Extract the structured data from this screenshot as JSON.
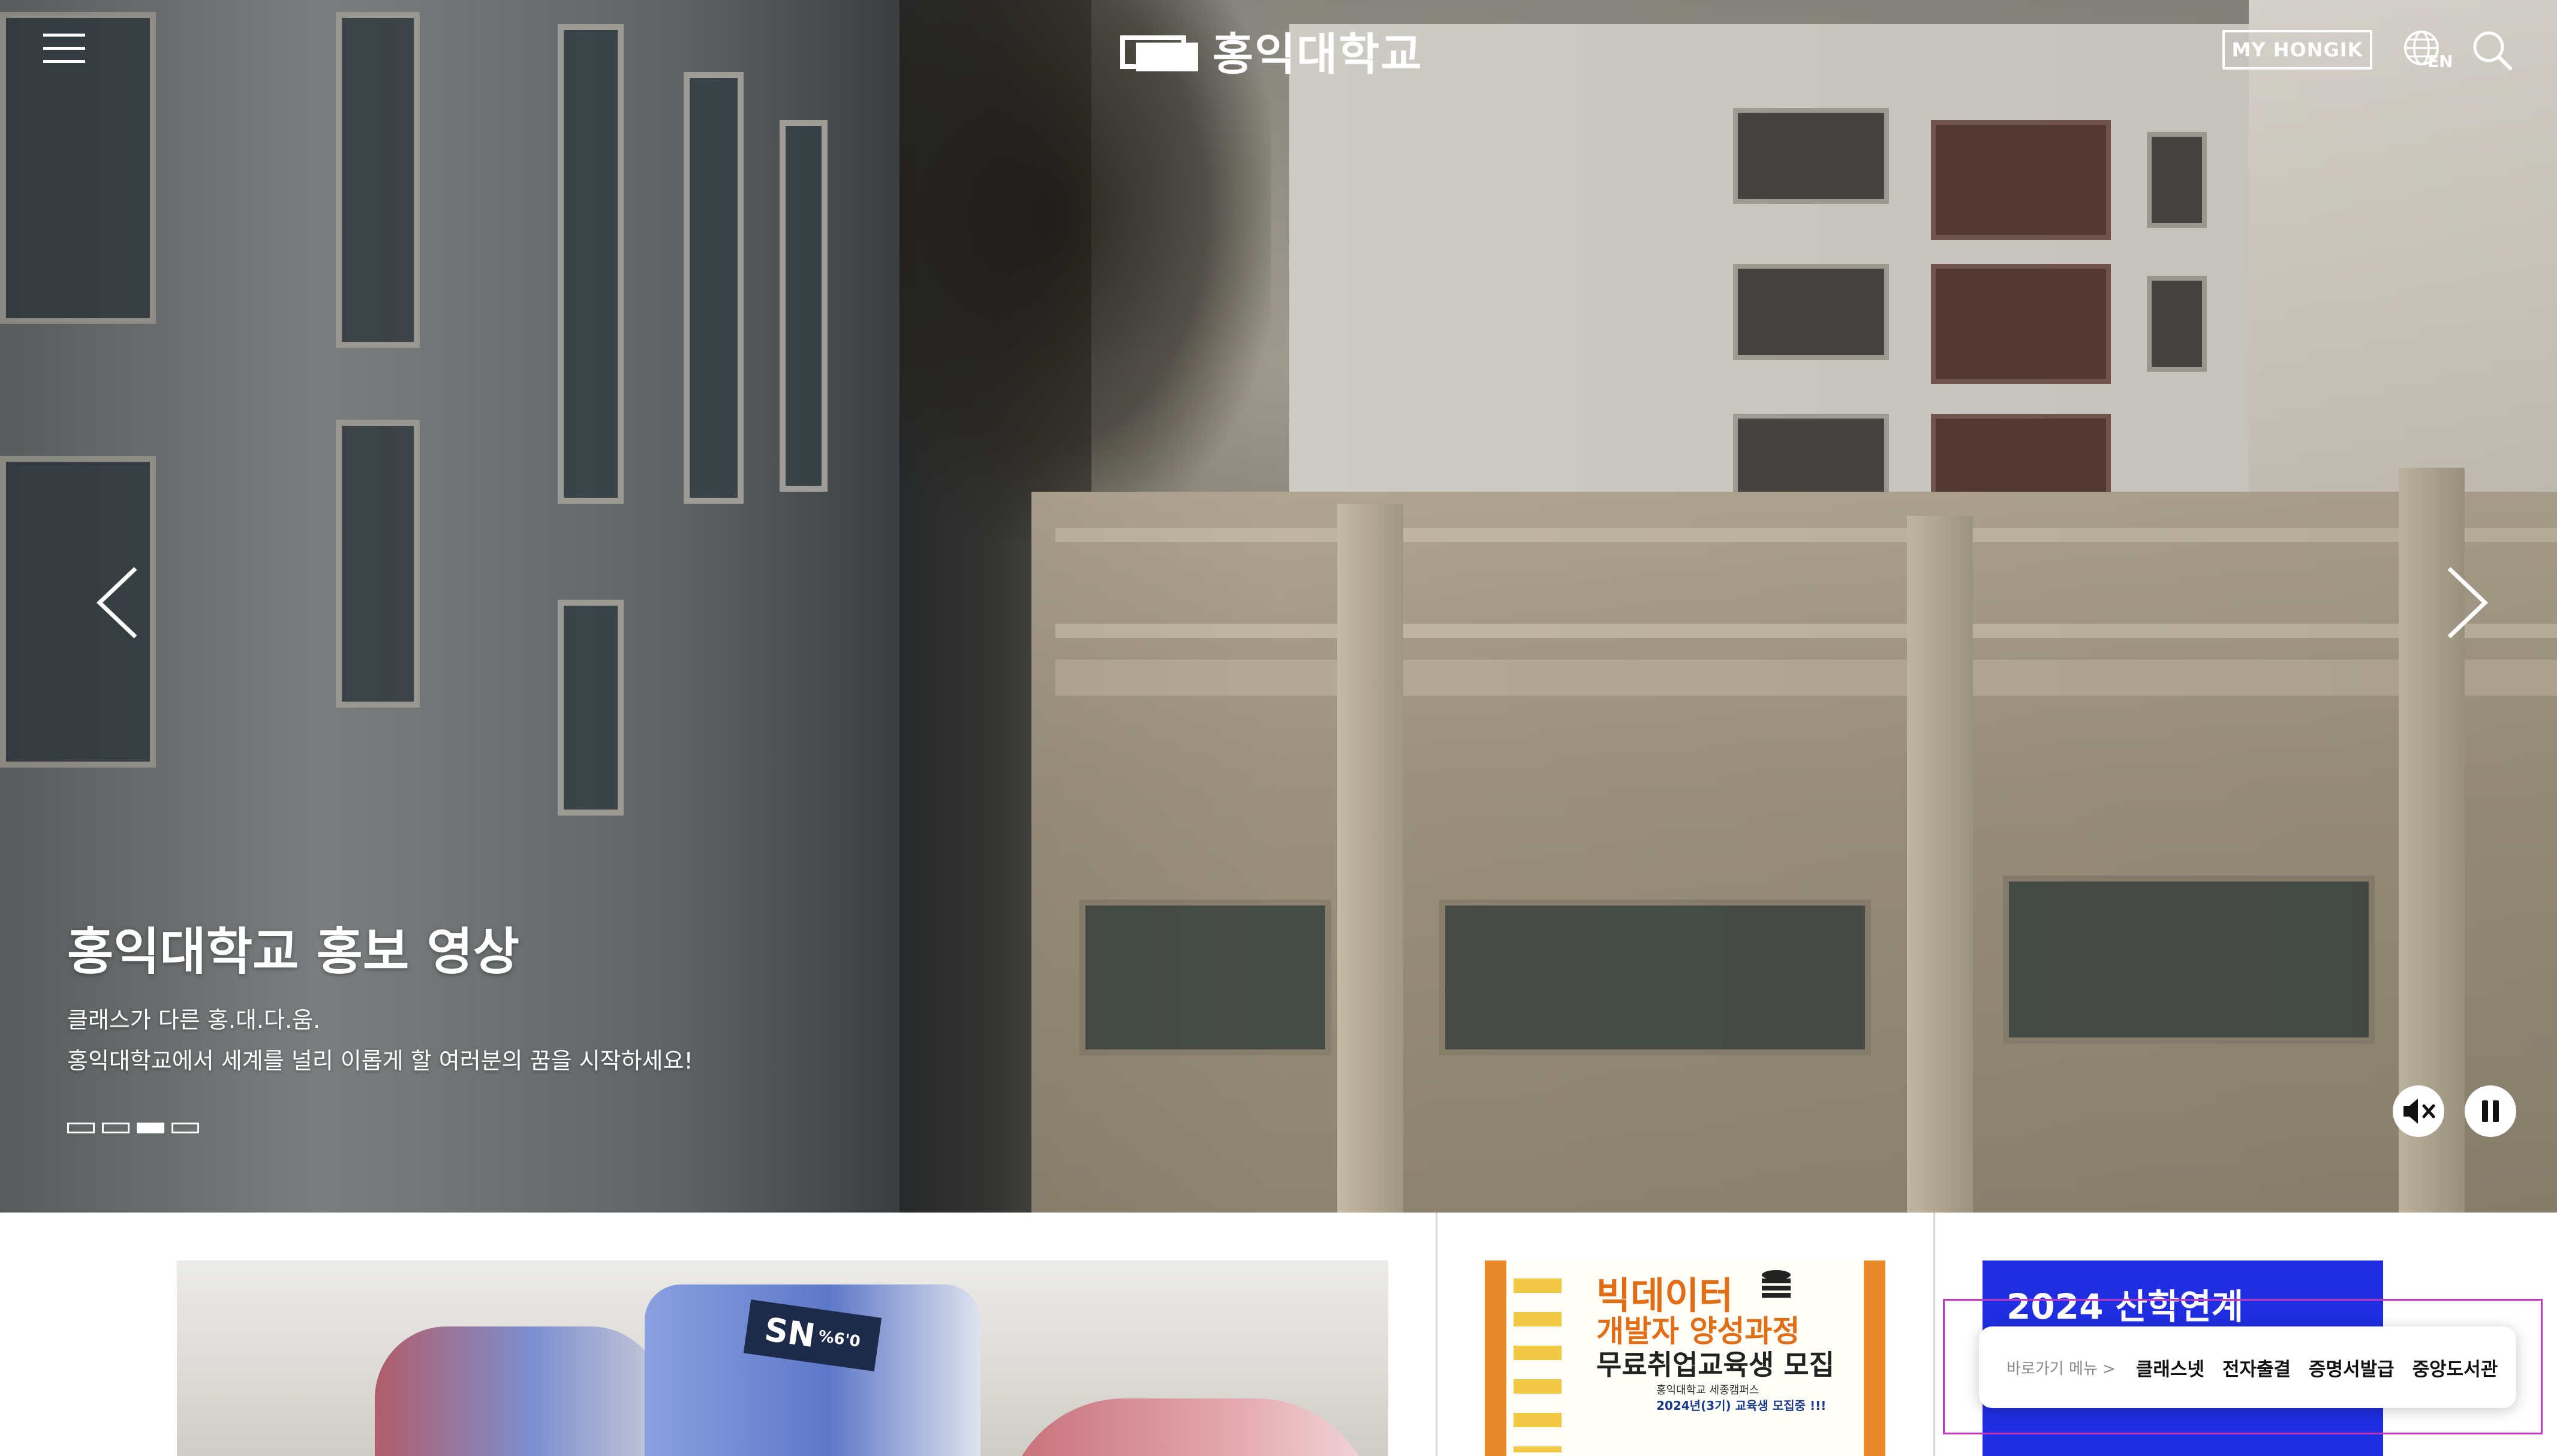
{
  "header": {
    "logo_text": "홍익대학교",
    "my_button": "MY HONGIK",
    "lang_label": "EN"
  },
  "hero": {
    "title": "홍익대학교 홍보 영상",
    "subtitle_line1": "클래스가 다른 홍.대.다.움.",
    "subtitle_line2": "홍익대학교에서 세계를 널리 이롭게 할 여러분의 꿈을 시작하세요!",
    "slide_count": 4,
    "active_slide": 3
  },
  "banners": {
    "bigdata": {
      "line1": "빅데이터",
      "line2": "개발자 양성과정",
      "line3": "무료취업교육생 모집",
      "small1": "홍익대학교 세종캠퍼스",
      "small2": "2024년(3기) 교육생 모집중 !!!"
    },
    "admission": {
      "title": "2024 산학연계"
    },
    "product": {
      "label": "SN",
      "label_sub": "%6'0"
    }
  },
  "quick_menu": {
    "label": "바로가기 메뉴 >",
    "items": [
      "클래스넷",
      "전자출결",
      "증명서발급",
      "중앙도서관"
    ]
  },
  "colors": {
    "accent_blue": "#1f2ee0",
    "accent_orange": "#e36d15",
    "highlight_outline": "#c236c2"
  },
  "icons": {
    "menu": "hamburger-menu-icon",
    "lang": "globe-icon",
    "search": "search-icon",
    "prev": "chevron-left-icon",
    "next": "chevron-right-icon",
    "mute": "volume-mute-icon",
    "pause": "pause-icon"
  }
}
